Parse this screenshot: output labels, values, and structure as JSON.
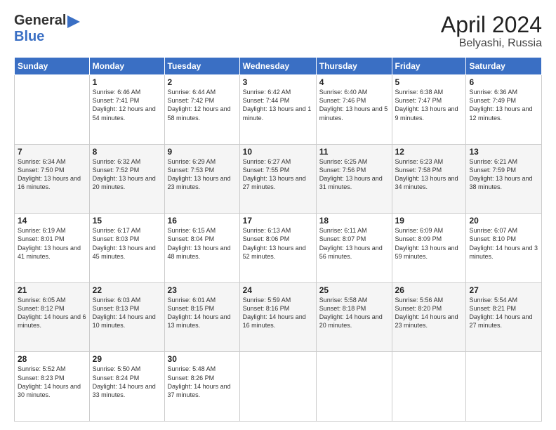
{
  "header": {
    "logo_general": "General",
    "logo_blue": "Blue",
    "title": "April 2024",
    "location": "Belyashi, Russia"
  },
  "weekdays": [
    "Sunday",
    "Monday",
    "Tuesday",
    "Wednesday",
    "Thursday",
    "Friday",
    "Saturday"
  ],
  "weeks": [
    [
      {
        "day": "",
        "sunrise": "",
        "sunset": "",
        "daylight": ""
      },
      {
        "day": "1",
        "sunrise": "Sunrise: 6:46 AM",
        "sunset": "Sunset: 7:41 PM",
        "daylight": "Daylight: 12 hours and 54 minutes."
      },
      {
        "day": "2",
        "sunrise": "Sunrise: 6:44 AM",
        "sunset": "Sunset: 7:42 PM",
        "daylight": "Daylight: 12 hours and 58 minutes."
      },
      {
        "day": "3",
        "sunrise": "Sunrise: 6:42 AM",
        "sunset": "Sunset: 7:44 PM",
        "daylight": "Daylight: 13 hours and 1 minute."
      },
      {
        "day": "4",
        "sunrise": "Sunrise: 6:40 AM",
        "sunset": "Sunset: 7:46 PM",
        "daylight": "Daylight: 13 hours and 5 minutes."
      },
      {
        "day": "5",
        "sunrise": "Sunrise: 6:38 AM",
        "sunset": "Sunset: 7:47 PM",
        "daylight": "Daylight: 13 hours and 9 minutes."
      },
      {
        "day": "6",
        "sunrise": "Sunrise: 6:36 AM",
        "sunset": "Sunset: 7:49 PM",
        "daylight": "Daylight: 13 hours and 12 minutes."
      }
    ],
    [
      {
        "day": "7",
        "sunrise": "Sunrise: 6:34 AM",
        "sunset": "Sunset: 7:50 PM",
        "daylight": "Daylight: 13 hours and 16 minutes."
      },
      {
        "day": "8",
        "sunrise": "Sunrise: 6:32 AM",
        "sunset": "Sunset: 7:52 PM",
        "daylight": "Daylight: 13 hours and 20 minutes."
      },
      {
        "day": "9",
        "sunrise": "Sunrise: 6:29 AM",
        "sunset": "Sunset: 7:53 PM",
        "daylight": "Daylight: 13 hours and 23 minutes."
      },
      {
        "day": "10",
        "sunrise": "Sunrise: 6:27 AM",
        "sunset": "Sunset: 7:55 PM",
        "daylight": "Daylight: 13 hours and 27 minutes."
      },
      {
        "day": "11",
        "sunrise": "Sunrise: 6:25 AM",
        "sunset": "Sunset: 7:56 PM",
        "daylight": "Daylight: 13 hours and 31 minutes."
      },
      {
        "day": "12",
        "sunrise": "Sunrise: 6:23 AM",
        "sunset": "Sunset: 7:58 PM",
        "daylight": "Daylight: 13 hours and 34 minutes."
      },
      {
        "day": "13",
        "sunrise": "Sunrise: 6:21 AM",
        "sunset": "Sunset: 7:59 PM",
        "daylight": "Daylight: 13 hours and 38 minutes."
      }
    ],
    [
      {
        "day": "14",
        "sunrise": "Sunrise: 6:19 AM",
        "sunset": "Sunset: 8:01 PM",
        "daylight": "Daylight: 13 hours and 41 minutes."
      },
      {
        "day": "15",
        "sunrise": "Sunrise: 6:17 AM",
        "sunset": "Sunset: 8:03 PM",
        "daylight": "Daylight: 13 hours and 45 minutes."
      },
      {
        "day": "16",
        "sunrise": "Sunrise: 6:15 AM",
        "sunset": "Sunset: 8:04 PM",
        "daylight": "Daylight: 13 hours and 48 minutes."
      },
      {
        "day": "17",
        "sunrise": "Sunrise: 6:13 AM",
        "sunset": "Sunset: 8:06 PM",
        "daylight": "Daylight: 13 hours and 52 minutes."
      },
      {
        "day": "18",
        "sunrise": "Sunrise: 6:11 AM",
        "sunset": "Sunset: 8:07 PM",
        "daylight": "Daylight: 13 hours and 56 minutes."
      },
      {
        "day": "19",
        "sunrise": "Sunrise: 6:09 AM",
        "sunset": "Sunset: 8:09 PM",
        "daylight": "Daylight: 13 hours and 59 minutes."
      },
      {
        "day": "20",
        "sunrise": "Sunrise: 6:07 AM",
        "sunset": "Sunset: 8:10 PM",
        "daylight": "Daylight: 14 hours and 3 minutes."
      }
    ],
    [
      {
        "day": "21",
        "sunrise": "Sunrise: 6:05 AM",
        "sunset": "Sunset: 8:12 PM",
        "daylight": "Daylight: 14 hours and 6 minutes."
      },
      {
        "day": "22",
        "sunrise": "Sunrise: 6:03 AM",
        "sunset": "Sunset: 8:13 PM",
        "daylight": "Daylight: 14 hours and 10 minutes."
      },
      {
        "day": "23",
        "sunrise": "Sunrise: 6:01 AM",
        "sunset": "Sunset: 8:15 PM",
        "daylight": "Daylight: 14 hours and 13 minutes."
      },
      {
        "day": "24",
        "sunrise": "Sunrise: 5:59 AM",
        "sunset": "Sunset: 8:16 PM",
        "daylight": "Daylight: 14 hours and 16 minutes."
      },
      {
        "day": "25",
        "sunrise": "Sunrise: 5:58 AM",
        "sunset": "Sunset: 8:18 PM",
        "daylight": "Daylight: 14 hours and 20 minutes."
      },
      {
        "day": "26",
        "sunrise": "Sunrise: 5:56 AM",
        "sunset": "Sunset: 8:20 PM",
        "daylight": "Daylight: 14 hours and 23 minutes."
      },
      {
        "day": "27",
        "sunrise": "Sunrise: 5:54 AM",
        "sunset": "Sunset: 8:21 PM",
        "daylight": "Daylight: 14 hours and 27 minutes."
      }
    ],
    [
      {
        "day": "28",
        "sunrise": "Sunrise: 5:52 AM",
        "sunset": "Sunset: 8:23 PM",
        "daylight": "Daylight: 14 hours and 30 minutes."
      },
      {
        "day": "29",
        "sunrise": "Sunrise: 5:50 AM",
        "sunset": "Sunset: 8:24 PM",
        "daylight": "Daylight: 14 hours and 33 minutes."
      },
      {
        "day": "30",
        "sunrise": "Sunrise: 5:48 AM",
        "sunset": "Sunset: 8:26 PM",
        "daylight": "Daylight: 14 hours and 37 minutes."
      },
      {
        "day": "",
        "sunrise": "",
        "sunset": "",
        "daylight": ""
      },
      {
        "day": "",
        "sunrise": "",
        "sunset": "",
        "daylight": ""
      },
      {
        "day": "",
        "sunrise": "",
        "sunset": "",
        "daylight": ""
      },
      {
        "day": "",
        "sunrise": "",
        "sunset": "",
        "daylight": ""
      }
    ]
  ]
}
